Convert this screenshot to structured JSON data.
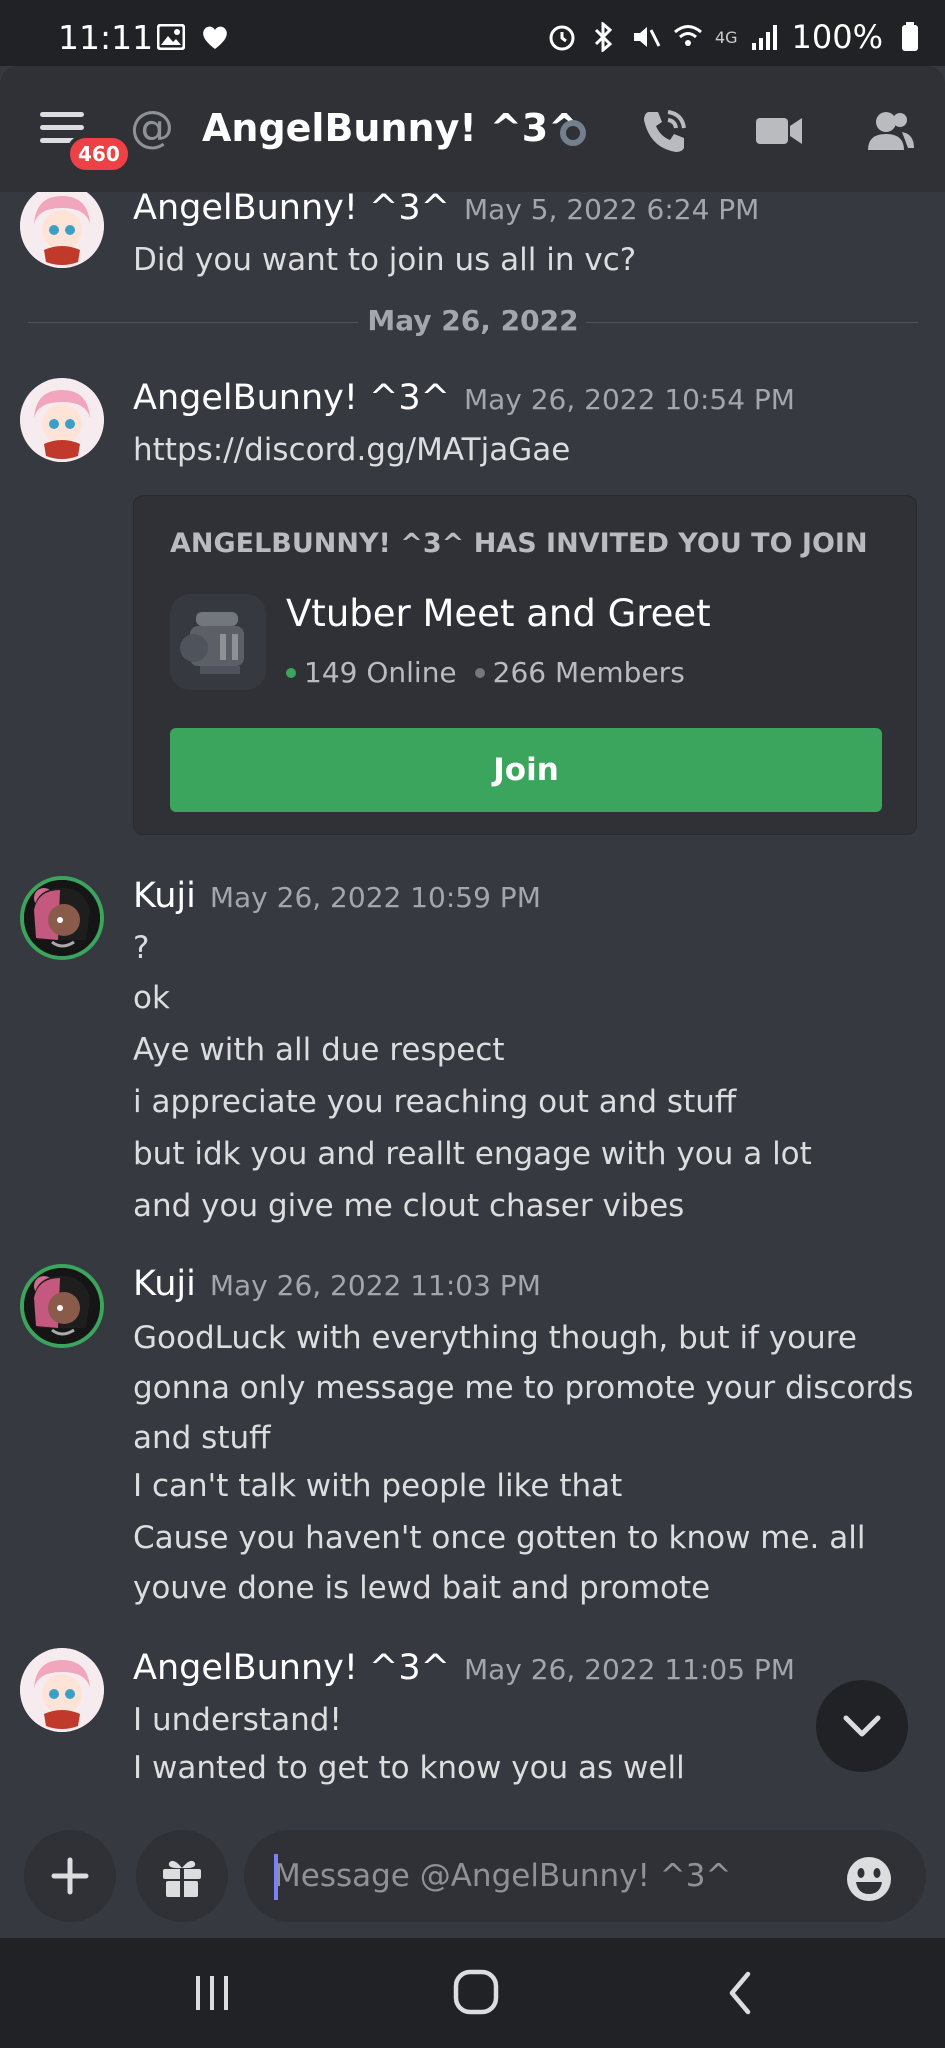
{
  "status_bar": {
    "time": "11:11",
    "battery": "100%",
    "network": "4G"
  },
  "header": {
    "notification_count": "460",
    "title": "AngelBunny! ^3^"
  },
  "messages": [
    {
      "author": "AngelBunny! ^3^",
      "timestamp": "May 5, 2022 6:24 PM",
      "lines": [
        "Did you want to join us all in vc?"
      ]
    },
    {
      "author": "AngelBunny! ^3^",
      "timestamp": "May 26, 2022 10:54 PM",
      "lines": [
        "https://discord.gg/MATjaGae"
      ]
    },
    {
      "author": "Kuji",
      "timestamp": "May 26, 2022 10:59 PM",
      "lines": [
        "?",
        "ok",
        "Aye with all due respect",
        "i appreciate you reaching out and stuff",
        "but idk you and reallt engage with you a lot",
        "and you give me clout chaser vibes"
      ]
    },
    {
      "author": "Kuji",
      "timestamp": "May 26, 2022 11:03 PM",
      "lines": [
        "GoodLuck with everything though, but if youre",
        "gonna only message me to promote your discords",
        "and stuff",
        "I can't talk with people like that",
        "Cause you haven't once gotten to know me. all",
        "youve done is lewd bait and promote"
      ]
    },
    {
      "author": "AngelBunny! ^3^",
      "timestamp": "May 26, 2022 11:05 PM",
      "lines": [
        "I understand!",
        "I wanted to get to know you as well"
      ]
    }
  ],
  "date_divider": "May 26, 2022",
  "invite": {
    "heading": "ANGELBUNNY! ^3^ HAS INVITED YOU TO JOIN",
    "guild_name": "Vtuber Meet and Greet",
    "online": "149 Online",
    "members": "266 Members",
    "join_label": "Join"
  },
  "composer": {
    "placeholder": "Message @AngelBunny! ^3^"
  },
  "colors": {
    "background": "#36393f",
    "link": "#00aff4",
    "join_button": "#3ba55d",
    "badge": "#ed4245"
  },
  "icons": {
    "header": [
      "menu-icon",
      "at-icon",
      "voice-call-icon",
      "video-call-icon",
      "members-icon"
    ],
    "composer": [
      "plus-icon",
      "gift-icon",
      "emoji-icon"
    ],
    "navbar": [
      "recents-icon",
      "home-icon",
      "back-icon"
    ]
  }
}
